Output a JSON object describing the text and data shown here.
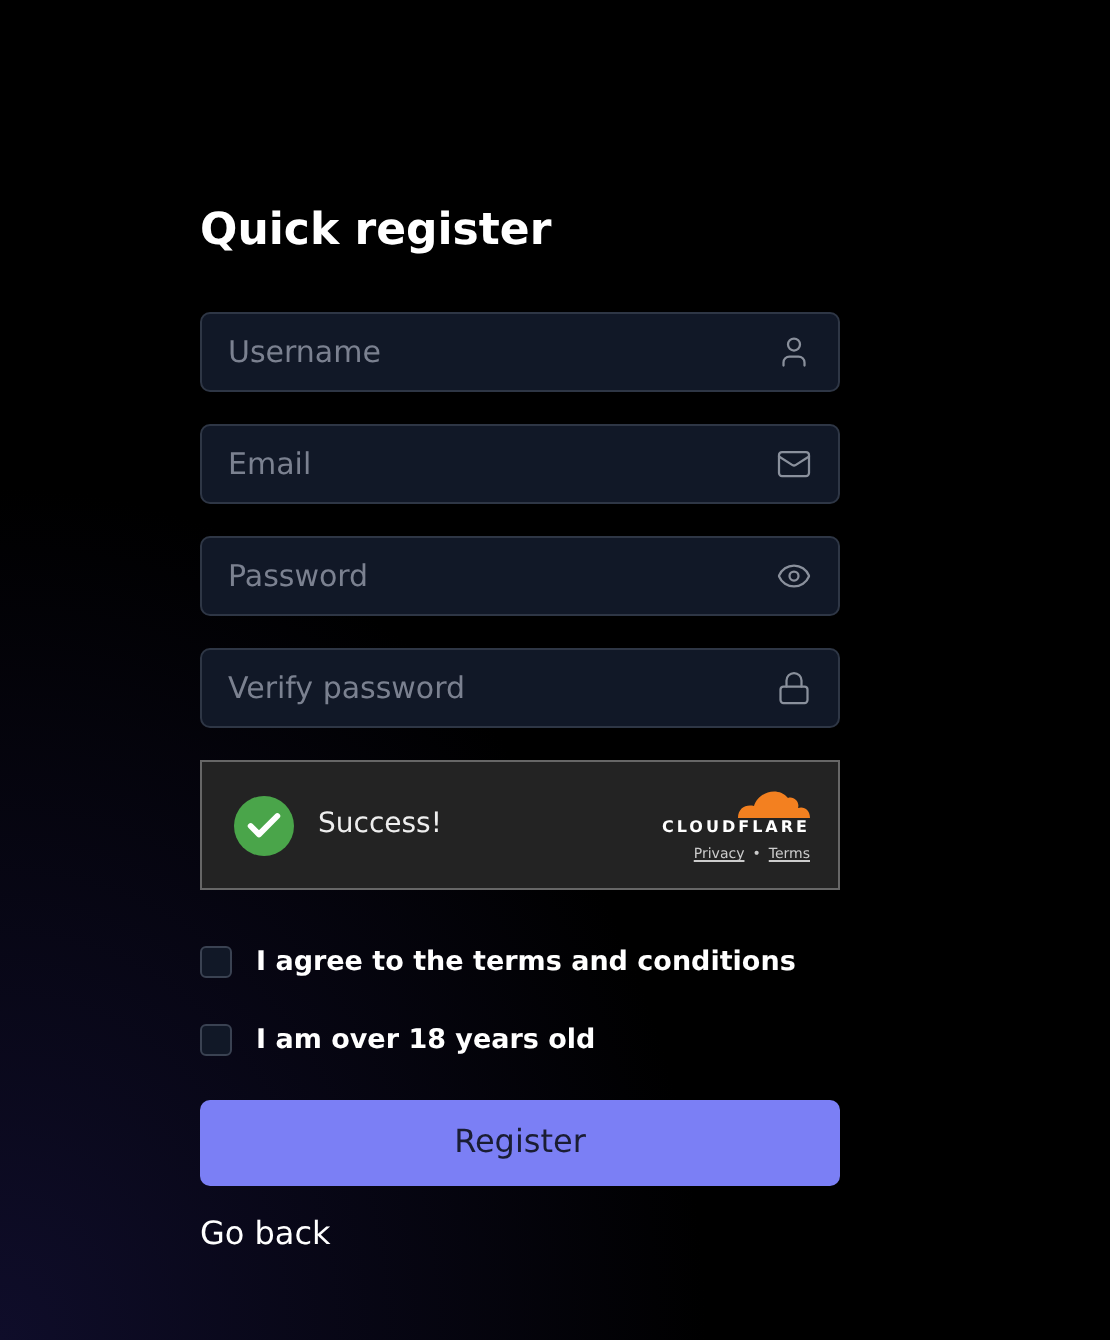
{
  "title": "Quick register",
  "fields": [
    {
      "placeholder": "Username",
      "kind": "user"
    },
    {
      "placeholder": "Email",
      "kind": "mail"
    },
    {
      "placeholder": "Password",
      "kind": "eye"
    },
    {
      "placeholder": "Verify password",
      "kind": "lock"
    }
  ],
  "captcha": {
    "status": "Success!",
    "checked": true,
    "brand": "CLOUDFLARE",
    "links": [
      "Privacy",
      "Terms"
    ],
    "separator": "•"
  },
  "checkboxes": [
    {
      "label": "I agree to the terms and conditions",
      "checked": false
    },
    {
      "label": "I am over 18 years old",
      "checked": false
    }
  ],
  "submit": "Register",
  "back_link": "Go back"
}
